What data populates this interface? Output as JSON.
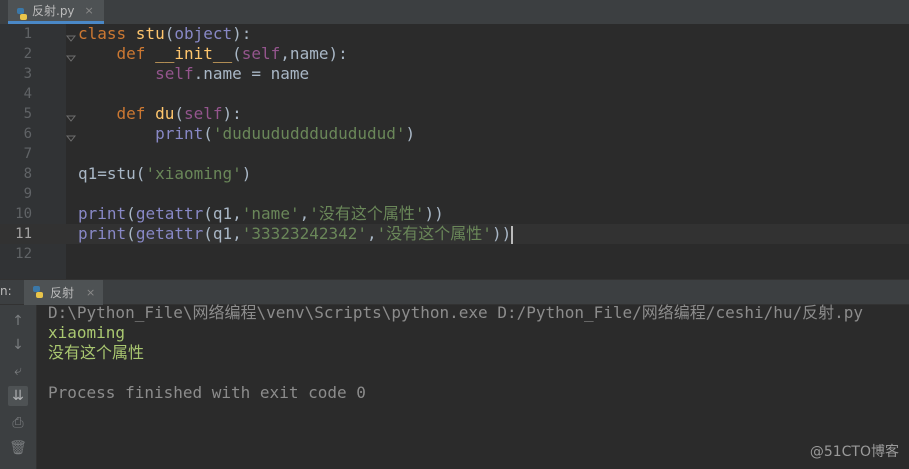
{
  "editor_tab": {
    "filename": "反射.py",
    "close": "×"
  },
  "editor": {
    "line_numbers": [
      "1",
      "2",
      "3",
      "4",
      "5",
      "6",
      "7",
      "8",
      "9",
      "10",
      "11",
      "12"
    ],
    "lines": [
      {
        "parts": [
          [
            "kw",
            "class "
          ],
          [
            "fn",
            "stu"
          ],
          [
            "",
            "("
          ],
          [
            "bi",
            "object"
          ],
          [
            "",
            "):"
          ]
        ]
      },
      {
        "parts": [
          [
            "",
            "    "
          ],
          [
            "kw",
            "def "
          ],
          [
            "fn",
            "__init__"
          ],
          [
            "",
            "("
          ],
          [
            "self",
            "self"
          ],
          [
            "",
            ",name):"
          ]
        ]
      },
      {
        "parts": [
          [
            "",
            "        "
          ],
          [
            "self",
            "self"
          ],
          [
            "",
            ".name = name"
          ]
        ]
      },
      {
        "parts": []
      },
      {
        "parts": [
          [
            "",
            "    "
          ],
          [
            "kw",
            "def "
          ],
          [
            "fn",
            "du"
          ],
          [
            "",
            "("
          ],
          [
            "self",
            "self"
          ],
          [
            "",
            "):"
          ]
        ]
      },
      {
        "parts": [
          [
            "",
            "        "
          ],
          [
            "bi",
            "print"
          ],
          [
            "",
            "("
          ],
          [
            "str",
            "'duduududddudududud'"
          ],
          [
            "",
            ")"
          ]
        ]
      },
      {
        "parts": []
      },
      {
        "parts": [
          [
            "",
            "q1=stu("
          ],
          [
            "str",
            "'xiaoming'"
          ],
          [
            "",
            ")"
          ]
        ]
      },
      {
        "parts": []
      },
      {
        "parts": [
          [
            "bi",
            "print"
          ],
          [
            "",
            "("
          ],
          [
            "bi",
            "getattr"
          ],
          [
            "",
            "(q1,"
          ],
          [
            "str",
            "'name'"
          ],
          [
            "",
            ","
          ],
          [
            "str",
            "'没有这个属性'"
          ],
          [
            "",
            "))"
          ]
        ]
      },
      {
        "parts": [
          [
            "bi",
            "print"
          ],
          [
            "",
            "("
          ],
          [
            "bi",
            "getattr"
          ],
          [
            "",
            "(q1,"
          ],
          [
            "str",
            "'33323242342'"
          ],
          [
            "",
            ","
          ],
          [
            "str",
            "'没有这个属性'"
          ],
          [
            "",
            "))"
          ]
        ]
      }
    ],
    "current_line": 11
  },
  "run_panel": {
    "prefix": "n:",
    "tab_label": "反射",
    "close": "×"
  },
  "console": {
    "command": "D:\\Python_File\\网络编程\\venv\\Scripts\\python.exe D:/Python_File/网络编程/ceshi/hu/反射.py",
    "output": [
      "xiaoming",
      "没有这个属性"
    ],
    "exit_message": "Process finished with exit code 0"
  },
  "tools": [
    "up-arrow-icon",
    "down-arrow-icon",
    "soft-wrap-icon",
    "scroll-to-end-icon",
    "print-icon",
    "trash-icon"
  ],
  "watermark": "@51CTO博客",
  "colors": {
    "keyword": "#cc7832",
    "function": "#ffc66d",
    "string": "#6a8759",
    "self": "#94558d",
    "builtin": "#8888c6",
    "background": "#2b2b2b"
  }
}
